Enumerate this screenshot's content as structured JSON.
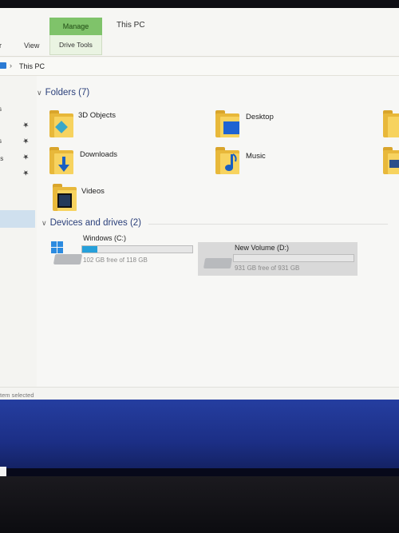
{
  "window": {
    "title": "This PC",
    "manage_tab": "Manage",
    "drive_tools_tab": "Drive Tools",
    "ribbon_tabs": [
      "er",
      "View"
    ]
  },
  "address": {
    "separator": "›",
    "breadcrumb": "This PC"
  },
  "nav": {
    "items": [
      "s",
      "s",
      "ts"
    ]
  },
  "folders": {
    "header": "Folders (7)",
    "items": [
      {
        "label": "3D Objects",
        "icon": "3d-objects-folder-icon"
      },
      {
        "label": "Desktop",
        "icon": "desktop-folder-icon"
      },
      {
        "label": "Downloads",
        "icon": "downloads-folder-icon"
      },
      {
        "label": "Music",
        "icon": "music-folder-icon"
      },
      {
        "label": "Videos",
        "icon": "videos-folder-icon"
      }
    ]
  },
  "drives": {
    "header": "Devices and drives (2)",
    "items": [
      {
        "name": "Windows (C:)",
        "free": "102 GB free of 118 GB",
        "used_fraction": 0.14,
        "icon": "windows-drive-icon"
      },
      {
        "name": "New Volume (D:)",
        "free": "931 GB free of 931 GB",
        "used_fraction": 0.0,
        "icon": "hard-drive-icon"
      }
    ]
  },
  "status": {
    "text": "tem selected"
  },
  "colors": {
    "accent": "#26a0da",
    "manage_tab": "#7fc36a",
    "folder": "#f7d35f",
    "taskbar": "#1c2f86",
    "group_header": "#2a3f7a"
  }
}
